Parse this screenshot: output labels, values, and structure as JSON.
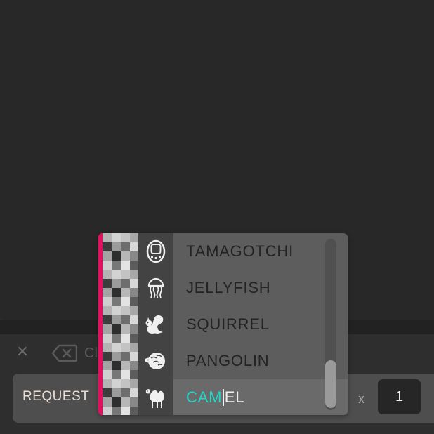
{
  "controls": {
    "clear_icon": "close-icon",
    "backspace_icon": "backspace-icon",
    "backspace_label": "Cl"
  },
  "request": {
    "label": "REQUEST",
    "quantity_prefix": "x",
    "quantity": "1"
  },
  "dropdown": {
    "accent_color": "#e0115f",
    "match_color": "#22d7c8",
    "items": [
      {
        "label": "TAMAGOTCHI",
        "icon": "tamagotchi-icon"
      },
      {
        "label": "JELLYFISH",
        "icon": "jellyfish-icon"
      },
      {
        "label": "SQUIRREL",
        "icon": "squirrel-icon"
      },
      {
        "label": "PANGOLIN",
        "icon": "pangolin-icon"
      },
      {
        "label": "CAMEL",
        "icon": "camel-icon",
        "typed": "CAM",
        "rest": "EL"
      }
    ]
  }
}
